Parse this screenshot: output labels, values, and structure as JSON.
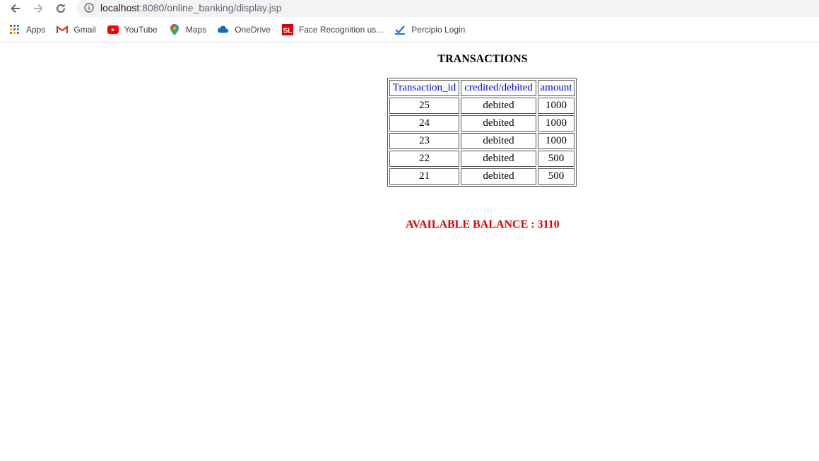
{
  "browser": {
    "url_host": "localhost",
    "url_path": ":8080/online_banking/display.jsp",
    "bookmarks": [
      {
        "label": "Apps",
        "icon": "apps-grid-icon"
      },
      {
        "label": "Gmail",
        "icon": "gmail-icon"
      },
      {
        "label": "YouTube",
        "icon": "youtube-icon"
      },
      {
        "label": "Maps",
        "icon": "maps-icon"
      },
      {
        "label": "OneDrive",
        "icon": "onedrive-icon"
      },
      {
        "label": "Face Recognition us...",
        "icon": "sl-icon"
      },
      {
        "label": "Percipio Login",
        "icon": "percipio-icon"
      }
    ]
  },
  "page": {
    "title": "TRANSACTIONS",
    "table": {
      "headers": [
        "Transaction_id",
        "credited/debited",
        "amount"
      ],
      "rows": [
        [
          "25",
          "debited",
          "1000"
        ],
        [
          "24",
          "debited",
          "1000"
        ],
        [
          "23",
          "debited",
          "1000"
        ],
        [
          "22",
          "debited",
          "500"
        ],
        [
          "21",
          "debited",
          "500"
        ]
      ]
    },
    "balance_text": "AVAILABLE BALANCE : 3110"
  },
  "colors": {
    "header_link": "#0000ee",
    "balance": "#e00000"
  }
}
